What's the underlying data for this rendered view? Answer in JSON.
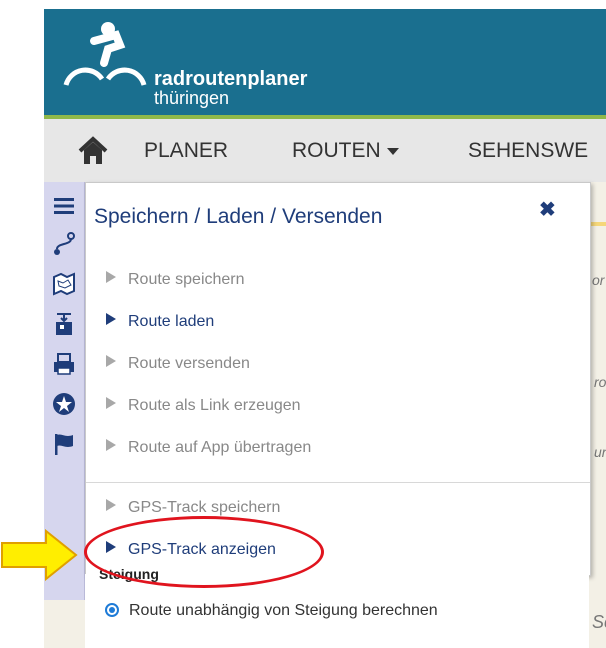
{
  "header": {
    "brand_name": "radroutenplaner",
    "brand_sub": "thüringen",
    "logo_icon": "cyclist-logo-icon"
  },
  "nav": {
    "home_icon": "home-icon",
    "items": [
      {
        "label": "PLANER"
      },
      {
        "label": "ROUTEN",
        "has_dropdown": true
      },
      {
        "label": "SEHENSWE"
      }
    ]
  },
  "toolbar": {
    "icons": [
      "menu-icon",
      "route-icon",
      "map-icon",
      "export-icon",
      "print-icon",
      "star-icon",
      "flag-icon"
    ]
  },
  "panel": {
    "title": "Speichern / Laden / Versenden",
    "close_label": "✖",
    "items": [
      {
        "label": "Route speichern",
        "active": false
      },
      {
        "label": "Route laden",
        "active": true
      },
      {
        "label": "Route versenden",
        "active": false
      },
      {
        "label": "Route als Link erzeugen",
        "active": false
      },
      {
        "label": "Route auf App übertragen",
        "active": false
      },
      {
        "label": "GPS-Track speichern",
        "active": false
      },
      {
        "label": "GPS-Track anzeigen",
        "active": true
      }
    ]
  },
  "below": {
    "section_label": "Steigung",
    "radio_label": "Route unabhängig von Steigung berechnen"
  },
  "map": {
    "labels": [
      "or",
      "ro",
      "un",
      "Sc"
    ]
  },
  "colors": {
    "header_bg": "#1a6f8f",
    "accent_green": "#8fb84a",
    "panel_title": "#1f3d7a",
    "highlight_ellipse": "#e0141e",
    "arrow_fill": "#ffee00"
  }
}
